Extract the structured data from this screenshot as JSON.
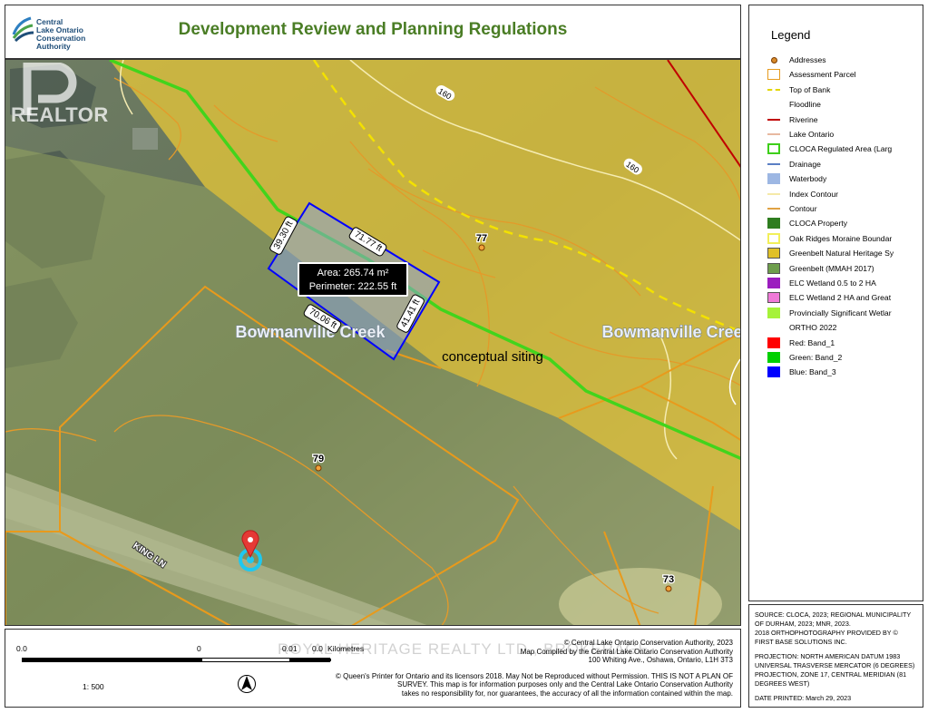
{
  "header": {
    "title": "Development Review and Planning Regulations",
    "logo_text": [
      "Central",
      "Lake Ontario",
      "Conservation",
      "Authority"
    ]
  },
  "watermarks": {
    "realtor": "REALTOR",
    "brokerage": "ROYAL HERITAGE REALTY LTD., BROKERAGE"
  },
  "map": {
    "contour_labels": [
      "160",
      "160"
    ],
    "addresses": [
      "77",
      "79",
      "73"
    ],
    "creek_labels": [
      "Bowmanville Creek",
      "Bowmanville Creek"
    ],
    "street_label": "KING LN",
    "siting_label": "conceptual siting",
    "measurement": {
      "area": "Area: 265.74 m²",
      "perimeter": "Perimeter: 222.55 ft",
      "sides": [
        "39.30 ft",
        "71.77 ft",
        "70.06 ft",
        "41.41 ft"
      ]
    }
  },
  "legend": {
    "title": "Legend",
    "items": [
      {
        "label": "Addresses",
        "icon": "address-point",
        "color": "#d88a2a"
      },
      {
        "label": "Assessment Parcel",
        "icon": "parcel-outline",
        "color": "#e69b1f"
      },
      {
        "label": "Top of Bank",
        "icon": "dashed-line",
        "color": "#e3d500"
      },
      {
        "label": "Floodline",
        "icon": "line",
        "color": "#ffffff"
      },
      {
        "label": "Riverine",
        "icon": "line",
        "color": "#c00000"
      },
      {
        "label": "Lake Ontario",
        "icon": "line",
        "color": "#e8b9a0"
      },
      {
        "label": "CLOCA Regulated Area (Larg",
        "icon": "regulated-outline",
        "color": "#3ecf1a"
      },
      {
        "label": "Drainage",
        "icon": "line",
        "color": "#5b7fc4"
      },
      {
        "label": "Waterbody",
        "icon": "fill",
        "color": "#9db7e3"
      },
      {
        "label": "Index Contour",
        "icon": "line",
        "color": "#f5e9a8"
      },
      {
        "label": "Contour",
        "icon": "line",
        "color": "#e0a243"
      },
      {
        "label": "CLOCA Property",
        "icon": "fill",
        "color": "#2e7d1f"
      },
      {
        "label": "Oak Ridges Moraine Boundar",
        "icon": "yellow-outline",
        "color": "#f2ef5a"
      },
      {
        "label": "Greenbelt Natural Heritage Sy",
        "icon": "fill-outline",
        "color": "#e0c028"
      },
      {
        "label": "Greenbelt (MMAH 2017)",
        "icon": "fill-outline",
        "color": "#6e9e4c"
      },
      {
        "label": "ELC Wetland 0.5 to 2 HA",
        "icon": "fill",
        "color": "#9b1dbf"
      },
      {
        "label": "ELC Wetland 2 HA and Great",
        "icon": "fill-outline",
        "color": "#f07ad8"
      },
      {
        "label": "Provincially Significant Wetlar",
        "icon": "fill",
        "color": "#a6f23a"
      },
      {
        "label": "ORTHO 2022",
        "icon": "none",
        "color": ""
      },
      {
        "label": "Red:   Band_1",
        "icon": "fill",
        "color": "#ff0000"
      },
      {
        "label": "Green: Band_2",
        "icon": "fill",
        "color": "#00d000"
      },
      {
        "label": "Blue:  Band_3",
        "icon": "fill",
        "color": "#0000ff"
      }
    ]
  },
  "source": {
    "line1": "SOURCE: CLOCA, 2023;  REGIONAL MUNICIPALITY OF DURHAM, 2023;  MNR, 2023.",
    "line2": "2018 ORTHOPHOTOGRAPHY PROVIDED BY © FIRST BASE SOLUTIONS INC.",
    "line3": "PROJECTION: NORTH AMERICAN DATUM 1983 UNIVERSAL TRASVERSE MERCATOR (6 DEGREES) PROJECTION, ZONE 17, CENTRAL MERIDIAN (81 DEGREES WEST)",
    "date": "DATE PRINTED:  March 29, 2023"
  },
  "scale": {
    "tick_0_left": "0.0",
    "tick_0_mid": "0",
    "tick_001": "0.01",
    "tick_00": "0.0",
    "units": "Kilometres",
    "ratio": "1: 500"
  },
  "credits": {
    "copyright": "© Central Lake Ontario Conservation Authority,  2023",
    "compiled": "Map Compiled by the Central Lake Ontario Conservation Authority",
    "address": "100 Whiting Ave., Oshawa, Ontario, L1H 3T3",
    "disclaimer1": "© Queen's Printer for Ontario and its licensors 2018. May Not be Reproduced without Permission.  THIS IS NOT A PLAN OF SURVEY. This map is for information purposes only and the Central Lake Ontario Conservation Authority",
    "disclaimer2": "takes no responsibility for, nor guarantees, the accuracy of all the information contained within the map."
  }
}
